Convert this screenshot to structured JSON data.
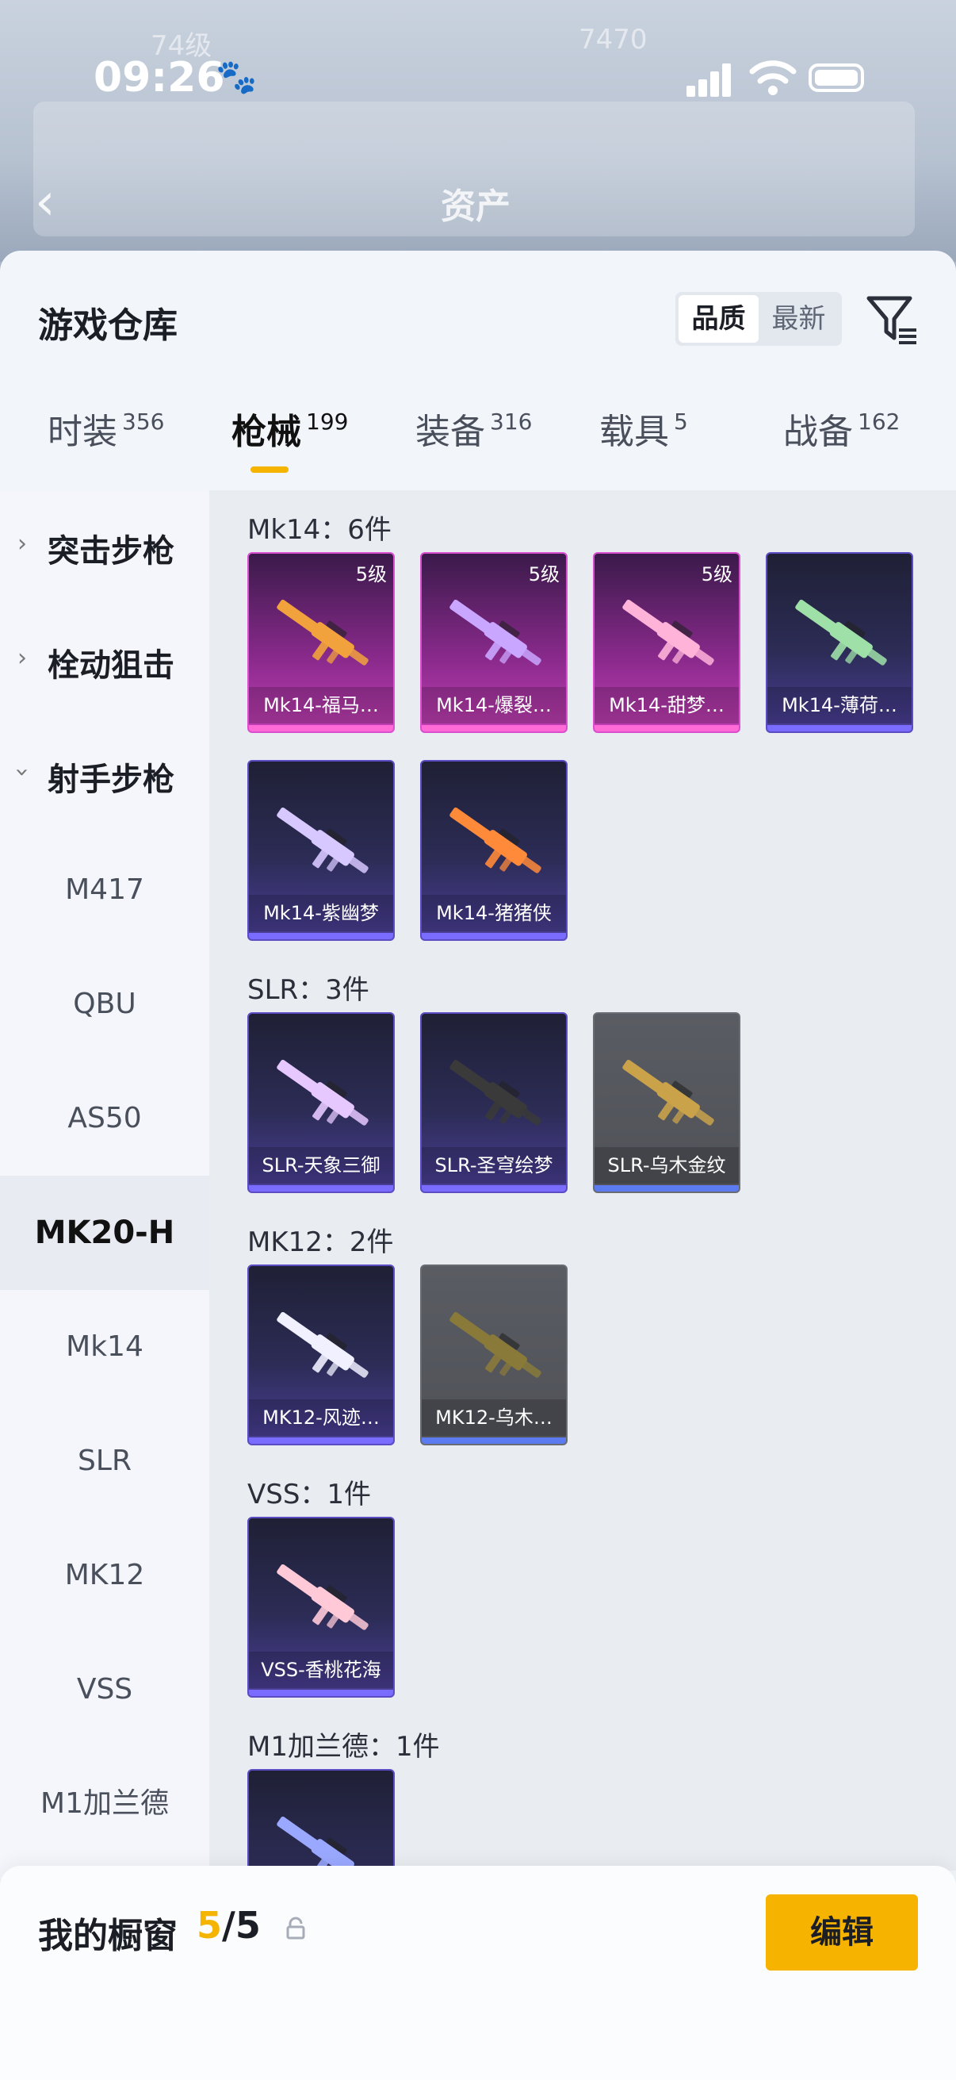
{
  "status_bar": {
    "time": "09:26"
  },
  "header": {
    "title": "资产"
  },
  "sheet": {
    "title": "游戏仓库",
    "sort": {
      "active": "品质",
      "inactive": "最新"
    }
  },
  "tabs": [
    {
      "label": "时装",
      "count": "356"
    },
    {
      "label": "枪械",
      "count": "199"
    },
    {
      "label": "装备",
      "count": "316"
    },
    {
      "label": "载具",
      "count": "5"
    },
    {
      "label": "战备",
      "count": "162"
    }
  ],
  "sidebar": {
    "categories": [
      {
        "label": "突击步枪"
      },
      {
        "label": "栓动狙击"
      },
      {
        "label": "射手步枪"
      }
    ],
    "subs": [
      "M417",
      "QBU",
      "AS50",
      "MK20-H",
      "Mk14",
      "SLR",
      "MK12",
      "VSS",
      "M1加兰德"
    ],
    "selected": "MK20-H"
  },
  "groups": [
    {
      "title": "Mk14：6件",
      "items": [
        {
          "name": "Mk14-福马…",
          "level": "5级",
          "rarity": "pink"
        },
        {
          "name": "Mk14-爆裂…",
          "level": "5级",
          "rarity": "pink"
        },
        {
          "name": "Mk14-甜梦…",
          "level": "5级",
          "rarity": "pink"
        },
        {
          "name": "Mk14-薄荷…",
          "level": "",
          "rarity": "purple"
        },
        {
          "name": "Mk14-紫幽梦",
          "level": "",
          "rarity": "purple"
        },
        {
          "name": "Mk14-猪猪侠",
          "level": "",
          "rarity": "purple"
        }
      ]
    },
    {
      "title": "SLR：3件",
      "items": [
        {
          "name": "SLR-天象三御",
          "level": "",
          "rarity": "purple"
        },
        {
          "name": "SLR-圣穹绘梦",
          "level": "",
          "rarity": "purple"
        },
        {
          "name": "SLR-乌木金纹",
          "level": "",
          "rarity": "grey"
        }
      ]
    },
    {
      "title": "MK12：2件",
      "items": [
        {
          "name": "MK12-风迹…",
          "level": "",
          "rarity": "purple"
        },
        {
          "name": "MK12-乌木…",
          "level": "",
          "rarity": "grey"
        }
      ]
    },
    {
      "title": "VSS：1件",
      "items": [
        {
          "name": "VSS-香桃花海",
          "level": "",
          "rarity": "purple"
        }
      ]
    },
    {
      "title": "M1加兰德：1件",
      "items": [
        {
          "name": "",
          "level": "",
          "rarity": "purple"
        }
      ]
    }
  ],
  "bottom": {
    "label": "我的橱窗",
    "current": "5",
    "total": "/5",
    "edit": "编辑"
  },
  "colors": {
    "accent": "#f5b400",
    "legendary": "#d94fd0",
    "epic": "#5b4cc4"
  }
}
